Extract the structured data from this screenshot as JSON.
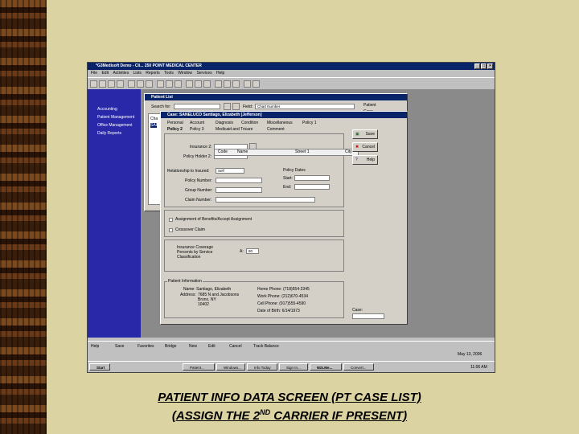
{
  "slide": {
    "caption_line1": "PATIENT INFO DATA SCREEN (PT CASE LIST)",
    "caption_line2_a": "(ASSIGN THE 2",
    "caption_line2_sup": "ND",
    "caption_line2_b": " CARRIER IF PRESENT)"
  },
  "app": {
    "title": "*G3Medisoft Demo - Cli... 250 POINT MEDICAL CENTER",
    "menu": [
      "File",
      "Edit",
      "Activities",
      "Lists",
      "Reports",
      "Tools",
      "Window",
      "Services",
      "Help"
    ],
    "sidebar": [
      "Accounting",
      "Patient Management",
      "Office Management",
      "Daily Reports"
    ]
  },
  "patient_list": {
    "title": "Patient List",
    "search_label": "Search for:",
    "field_label": "Field:",
    "field_value": "Chart Number",
    "patient_radio": "Patient",
    "case_radio": "Case",
    "rows": [
      "Cha",
      "SAI"
    ]
  },
  "case_dialog": {
    "title": "Case: SANELUCO Santiago, Elizabeth [Jefferson]",
    "tabs_row1": [
      "Personal",
      "Account",
      "Diagnosis",
      "Condition",
      "Miscellaneous",
      "Policy 1"
    ],
    "tabs_row2": [
      "Policy 2",
      "Policy 3",
      "Medicaid and Tricare",
      "Comment"
    ],
    "insurance_label": "Insurance 2:",
    "policy_holder_label": "Policy Holder 2:",
    "lookup_cols": [
      "Code",
      "Name",
      "Street 1",
      "City"
    ],
    "relationship_label": "Relationship to Insured:",
    "relationship_value": "Self",
    "policy_number_label": "Policy Number:",
    "group_number_label": "Group Number:",
    "claim_number_label": "Claim Number:",
    "policy_dates_label": "Policy Dates",
    "start_label": "Start:",
    "end_label": "End:",
    "assignment_label": "Assignment of Benefits/Accept Assignment",
    "crossover_label": "Crossover Claim",
    "coverage_label": "Insurance Coverage Percents by Service Classification",
    "coverage_class": "A:",
    "coverage_value": "80",
    "patient_info_label": "Patient Information",
    "name_line": "Name: Santiago, Elizabeth",
    "address_label": "Address:",
    "address_line1": "7685 N and Jacobsons",
    "address_line2": "Bronx, NY",
    "address_line3": "10402",
    "home_phone": "Home Phone: (718)554-2345",
    "work_phone": "Work Phone: (212)670-4534",
    "cell_phone": "Cell Phone: (917)555-4590",
    "dob": "Date of Birth: 6/14/1973",
    "save_btn": "Save",
    "cancel_btn": "Cancel",
    "help_btn": "Help",
    "case_label": "Case:"
  },
  "bottombar": [
    "Help",
    "Save",
    "Favorites",
    "Bridge",
    "New",
    "Edit",
    "Cancel",
    "Track Balance"
  ],
  "status_date": "May 13, 2006",
  "taskbar": {
    "start": "Start",
    "items": [
      "Patient...",
      "Windows...",
      "Info Today",
      "Sign In...",
      "NDLMe...",
      "Convert..."
    ],
    "clock": "11:06 AM"
  },
  "colors": {
    "sidebar": "#2828a8",
    "titlebar": "#0a246a",
    "slide_bg": "#dcd3a3"
  }
}
